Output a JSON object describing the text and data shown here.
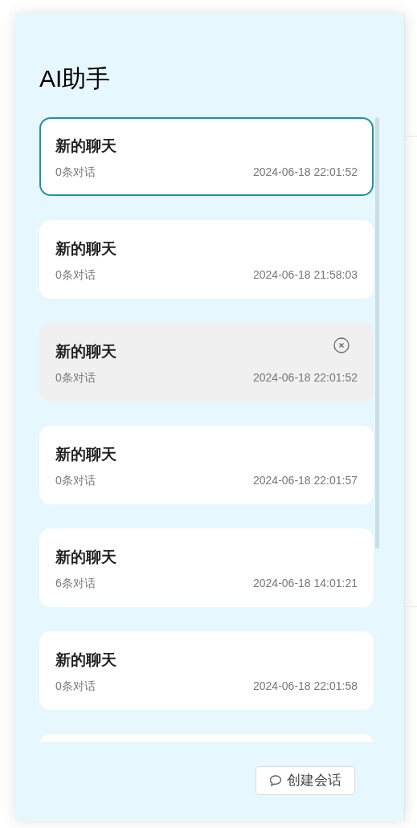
{
  "title": "AI助手",
  "chats": [
    {
      "title": "新的聊天",
      "count": "0条对话",
      "time": "2024-06-18 22:01:52",
      "selected": true,
      "hovered": false
    },
    {
      "title": "新的聊天",
      "count": "0条对话",
      "time": "2024-06-18 21:58:03",
      "selected": false,
      "hovered": false
    },
    {
      "title": "新的聊天",
      "count": "0条对话",
      "time": "2024-06-18 22:01:52",
      "selected": false,
      "hovered": true
    },
    {
      "title": "新的聊天",
      "count": "0条对话",
      "time": "2024-06-18 22:01:57",
      "selected": false,
      "hovered": false
    },
    {
      "title": "新的聊天",
      "count": "6条对话",
      "time": "2024-06-18 14:01:21",
      "selected": false,
      "hovered": false
    },
    {
      "title": "新的聊天",
      "count": "0条对话",
      "time": "2024-06-18 22:01:58",
      "selected": false,
      "hovered": false
    }
  ],
  "new_chat_button": "创建会话"
}
